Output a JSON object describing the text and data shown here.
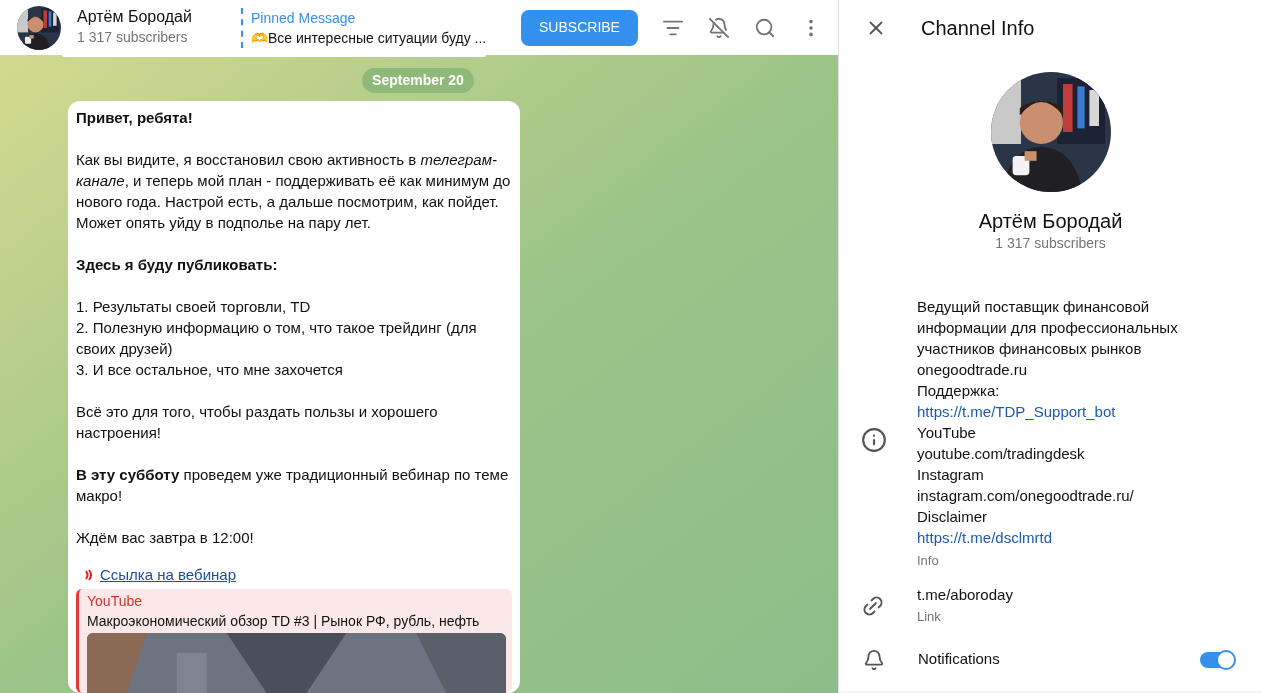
{
  "header": {
    "channel_name": "Артём Бородай",
    "subscribers": "1 317 subscribers",
    "pinned": {
      "label": "Pinned Message",
      "text": "🫶Все интересные ситуации буду ..."
    },
    "subscribe_button": "SUBSCRIBE"
  },
  "chat": {
    "date": "September 20",
    "message": {
      "paragraphs": [
        {
          "kind": "text",
          "lines": [
            "**Привет, ребята!**"
          ]
        },
        {
          "kind": "text",
          "lines": [
            "Как вы видите, я восстановил свою активность в *телеграм-канале*, и теперь мой план - поддерживать её как минимум до нового года. Настрой есть, а дальше посмотрим, как пойдет. Может опять уйду в подполье на пару лет."
          ]
        },
        {
          "kind": "text",
          "lines": [
            "**Здесь я буду публиковать:**"
          ]
        },
        {
          "kind": "text",
          "lines": [
            "1. Результаты своей торговли, TD",
            "2. Полезную информацию о том, что такое трейдинг (для своих друзей)",
            "3. И все остальное, что мне захочется"
          ]
        },
        {
          "kind": "text",
          "lines": [
            "Всё это для того, чтобы раздать пользы и хорошего настроения!"
          ]
        },
        {
          "kind": "text",
          "lines": [
            "**В эту субботу** проведем уже традиционный вебинар по теме макро!"
          ]
        },
        {
          "kind": "text",
          "lines": [
            "Ждём вас завтра в 12:00!"
          ]
        },
        {
          "kind": "link",
          "lines": [
            "Ссылка на вебинар"
          ]
        }
      ],
      "preview": {
        "site": "YouTube",
        "title": "Макроэкономический обзор TD #3 | Рынок РФ, рубль, нефть"
      }
    }
  },
  "channel_info": {
    "title": "Channel Info",
    "name": "Артём Бородай",
    "subscribers": "1 317 subscribers",
    "description": [
      {
        "kind": "text",
        "text": "Ведущий поставщик финансовой информации для профессиональных участников финансовых рынков"
      },
      {
        "kind": "text",
        "text": "onegoodtrade.ru"
      },
      {
        "kind": "text",
        "text": "Поддержка:"
      },
      {
        "kind": "link",
        "text": "https://t.me/TDP_Support_bot"
      },
      {
        "kind": "text",
        "text": "YouTube"
      },
      {
        "kind": "text",
        "text": "youtube.com/tradingdesk"
      },
      {
        "kind": "text",
        "text": "Instagram"
      },
      {
        "kind": "text",
        "text": "instagram.com/onegoodtrade.ru/"
      },
      {
        "kind": "text",
        "text": "Disclaimer"
      },
      {
        "kind": "link",
        "text": "https://t.me/dsclmrtd"
      }
    ],
    "description_caption": "Info",
    "link": {
      "value": "t.me/aboroday",
      "caption": "Link"
    },
    "notifications": {
      "label": "Notifications",
      "on": true
    }
  }
}
